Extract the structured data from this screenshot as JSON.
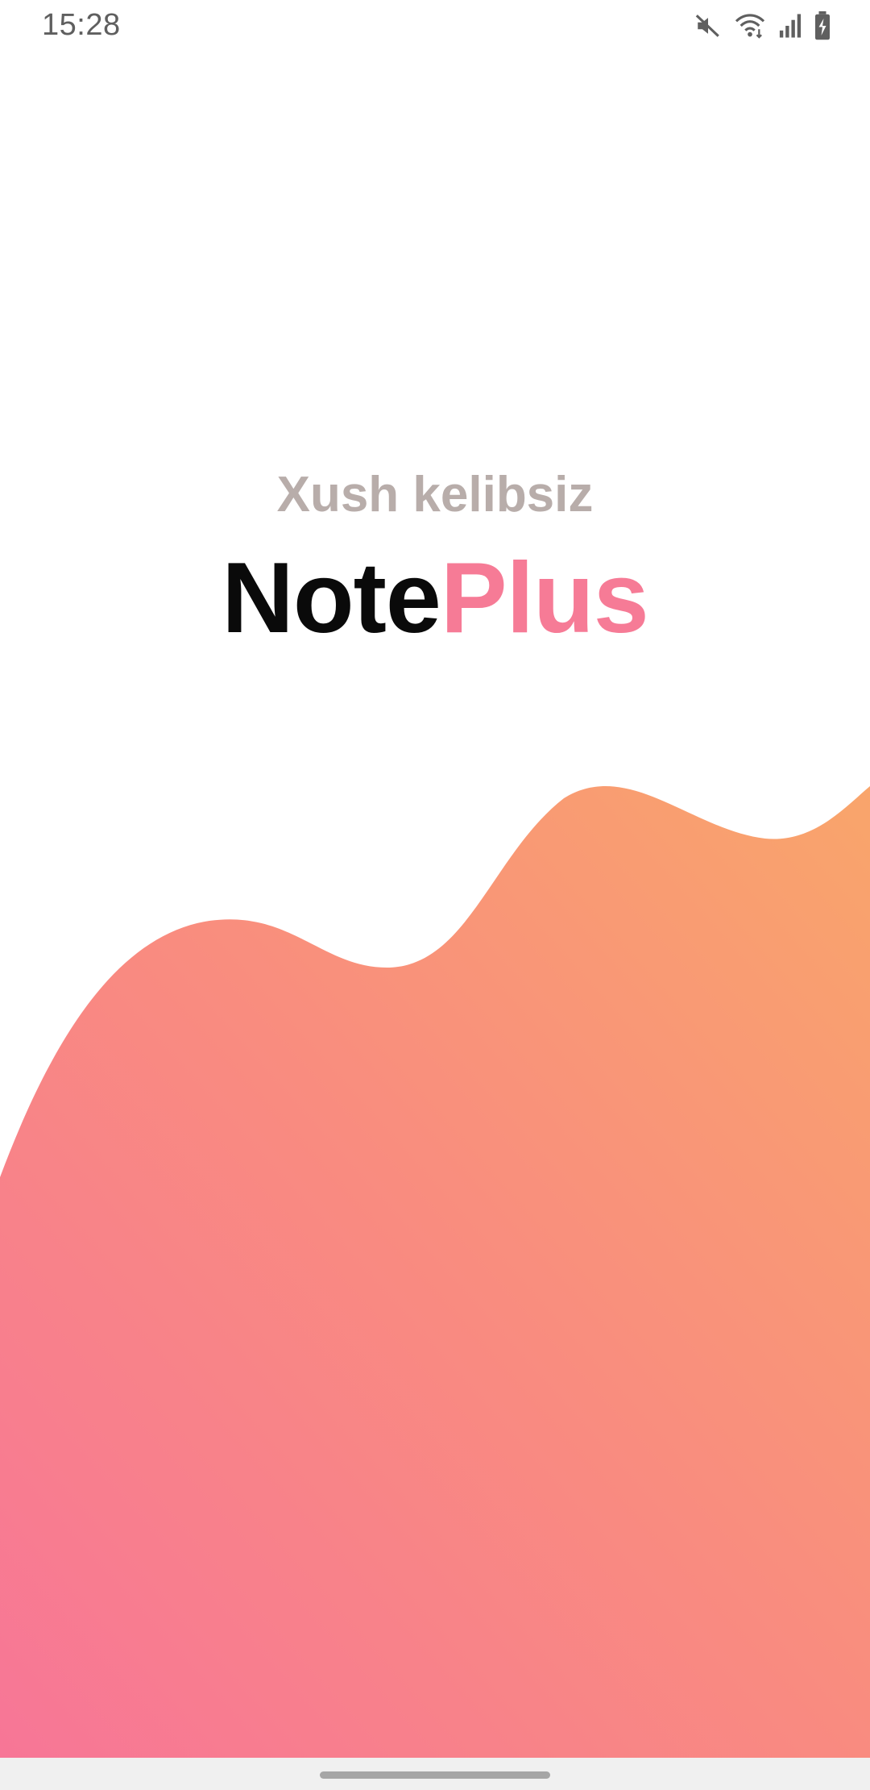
{
  "status_bar": {
    "time": "15:28",
    "icons": [
      "mute-icon",
      "wifi-icon",
      "signal-icon",
      "battery-charging-icon"
    ]
  },
  "welcome": {
    "greeting": "Xush kelibsiz",
    "brand_part1": "Note",
    "brand_part2": "Plus"
  },
  "colors": {
    "brand_accent": "#f67b96",
    "greeting_text": "#b8adaa",
    "wave_orange": "#f9a26e",
    "wave_pink": "#f77895"
  },
  "navigation": {
    "home_handle": "home-gesture-handle"
  }
}
